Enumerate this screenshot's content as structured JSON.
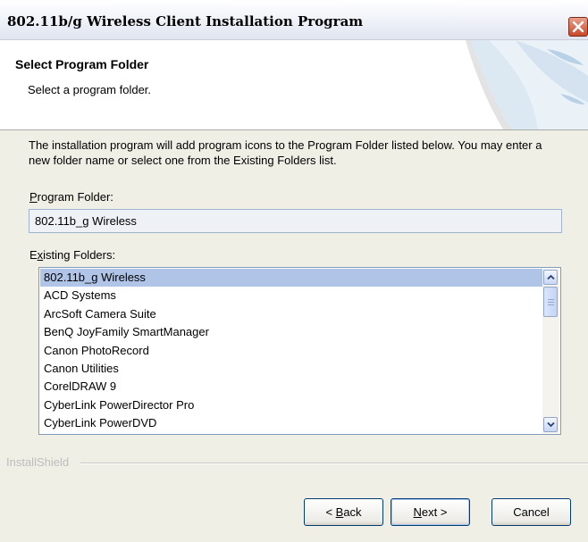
{
  "window": {
    "title": "802.11b/g Wireless Client Installation Program"
  },
  "header": {
    "title": "Select Program Folder",
    "subtitle": "Select a program folder."
  },
  "content": {
    "description": "The installation program will add program icons to the Program Folder listed below. You may enter a new folder name or select one from the Existing Folders list.",
    "program_folder_label": {
      "mnemonic": "P",
      "rest": "rogram Folder:"
    },
    "program_folder_value": "802.11b_g Wireless",
    "existing_folders_label": {
      "pre": "E",
      "mnemonic": "x",
      "rest": "isting Folders:"
    },
    "existing_folders": [
      "802.11b_g Wireless",
      "ACD Systems",
      "ArcSoft Camera Suite",
      "BenQ JoyFamily SmartManager",
      "Canon PhotoRecord",
      "Canon Utilities",
      "CorelDRAW 9",
      "CyberLink PowerDirector Pro",
      "CyberLink PowerDVD"
    ],
    "selected_index": 0
  },
  "footer": {
    "brand": "InstallShield",
    "back": {
      "pre": "< ",
      "mnemonic": "B",
      "rest": "ack"
    },
    "next": {
      "mnemonic": "N",
      "rest": "ext >"
    },
    "cancel": "Cancel"
  },
  "colors": {
    "selection": "#b0c4e8",
    "close_button": "#c9472a",
    "dialog_background": "#f0efe6"
  },
  "icons": {
    "close": "close-icon",
    "scroll_up": "chevron-up-icon",
    "scroll_down": "chevron-down-icon"
  }
}
